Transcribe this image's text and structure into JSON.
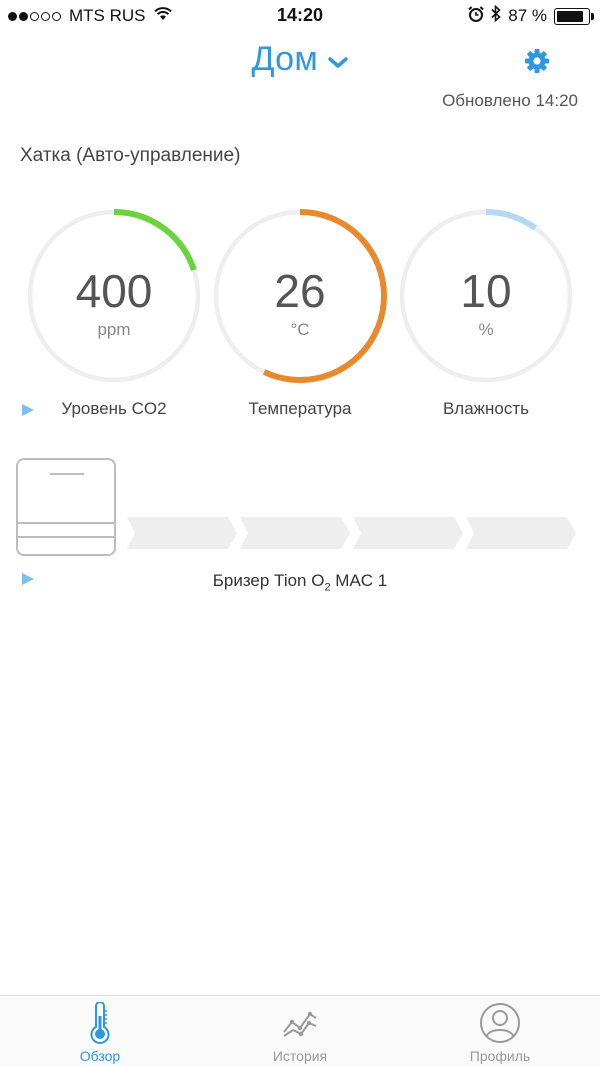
{
  "status_bar": {
    "carrier": "MTS RUS",
    "time": "14:20",
    "battery": "87 %",
    "battery_level": 0.87,
    "signal_dots_filled": 2,
    "signal_dots_total": 5
  },
  "header": {
    "title": "Дом",
    "updated": "Обновлено 14:20"
  },
  "room": {
    "title": "Хатка (Авто-управление)"
  },
  "gauges": [
    {
      "value": "400",
      "unit": "ppm",
      "label": "Уровень CO2",
      "fraction": 0.2,
      "color": "#6bd33e"
    },
    {
      "value": "26",
      "unit": "°C",
      "label": "Температура",
      "fraction": 0.57,
      "color": "#e8892e"
    },
    {
      "value": "10",
      "unit": "%",
      "label": "Влажность",
      "fraction": 0.1,
      "color": "#b6d9f2"
    }
  ],
  "breezer": {
    "label_prefix": "Бризер Tion O",
    "label_sub": "2",
    "label_suffix": " MAC 1",
    "speed_segments": 4
  },
  "tabs": [
    {
      "label": "Обзор",
      "icon": "thermometer-icon",
      "active": true
    },
    {
      "label": "История",
      "icon": "chart-line-icon",
      "active": false
    },
    {
      "label": "Профиль",
      "icon": "profile-icon",
      "active": false
    }
  ],
  "colors": {
    "accent": "#2e97e0",
    "play_marker": "#7cc0ec",
    "track": "#eeeeee",
    "chevron_fill": "#eeeeee"
  }
}
